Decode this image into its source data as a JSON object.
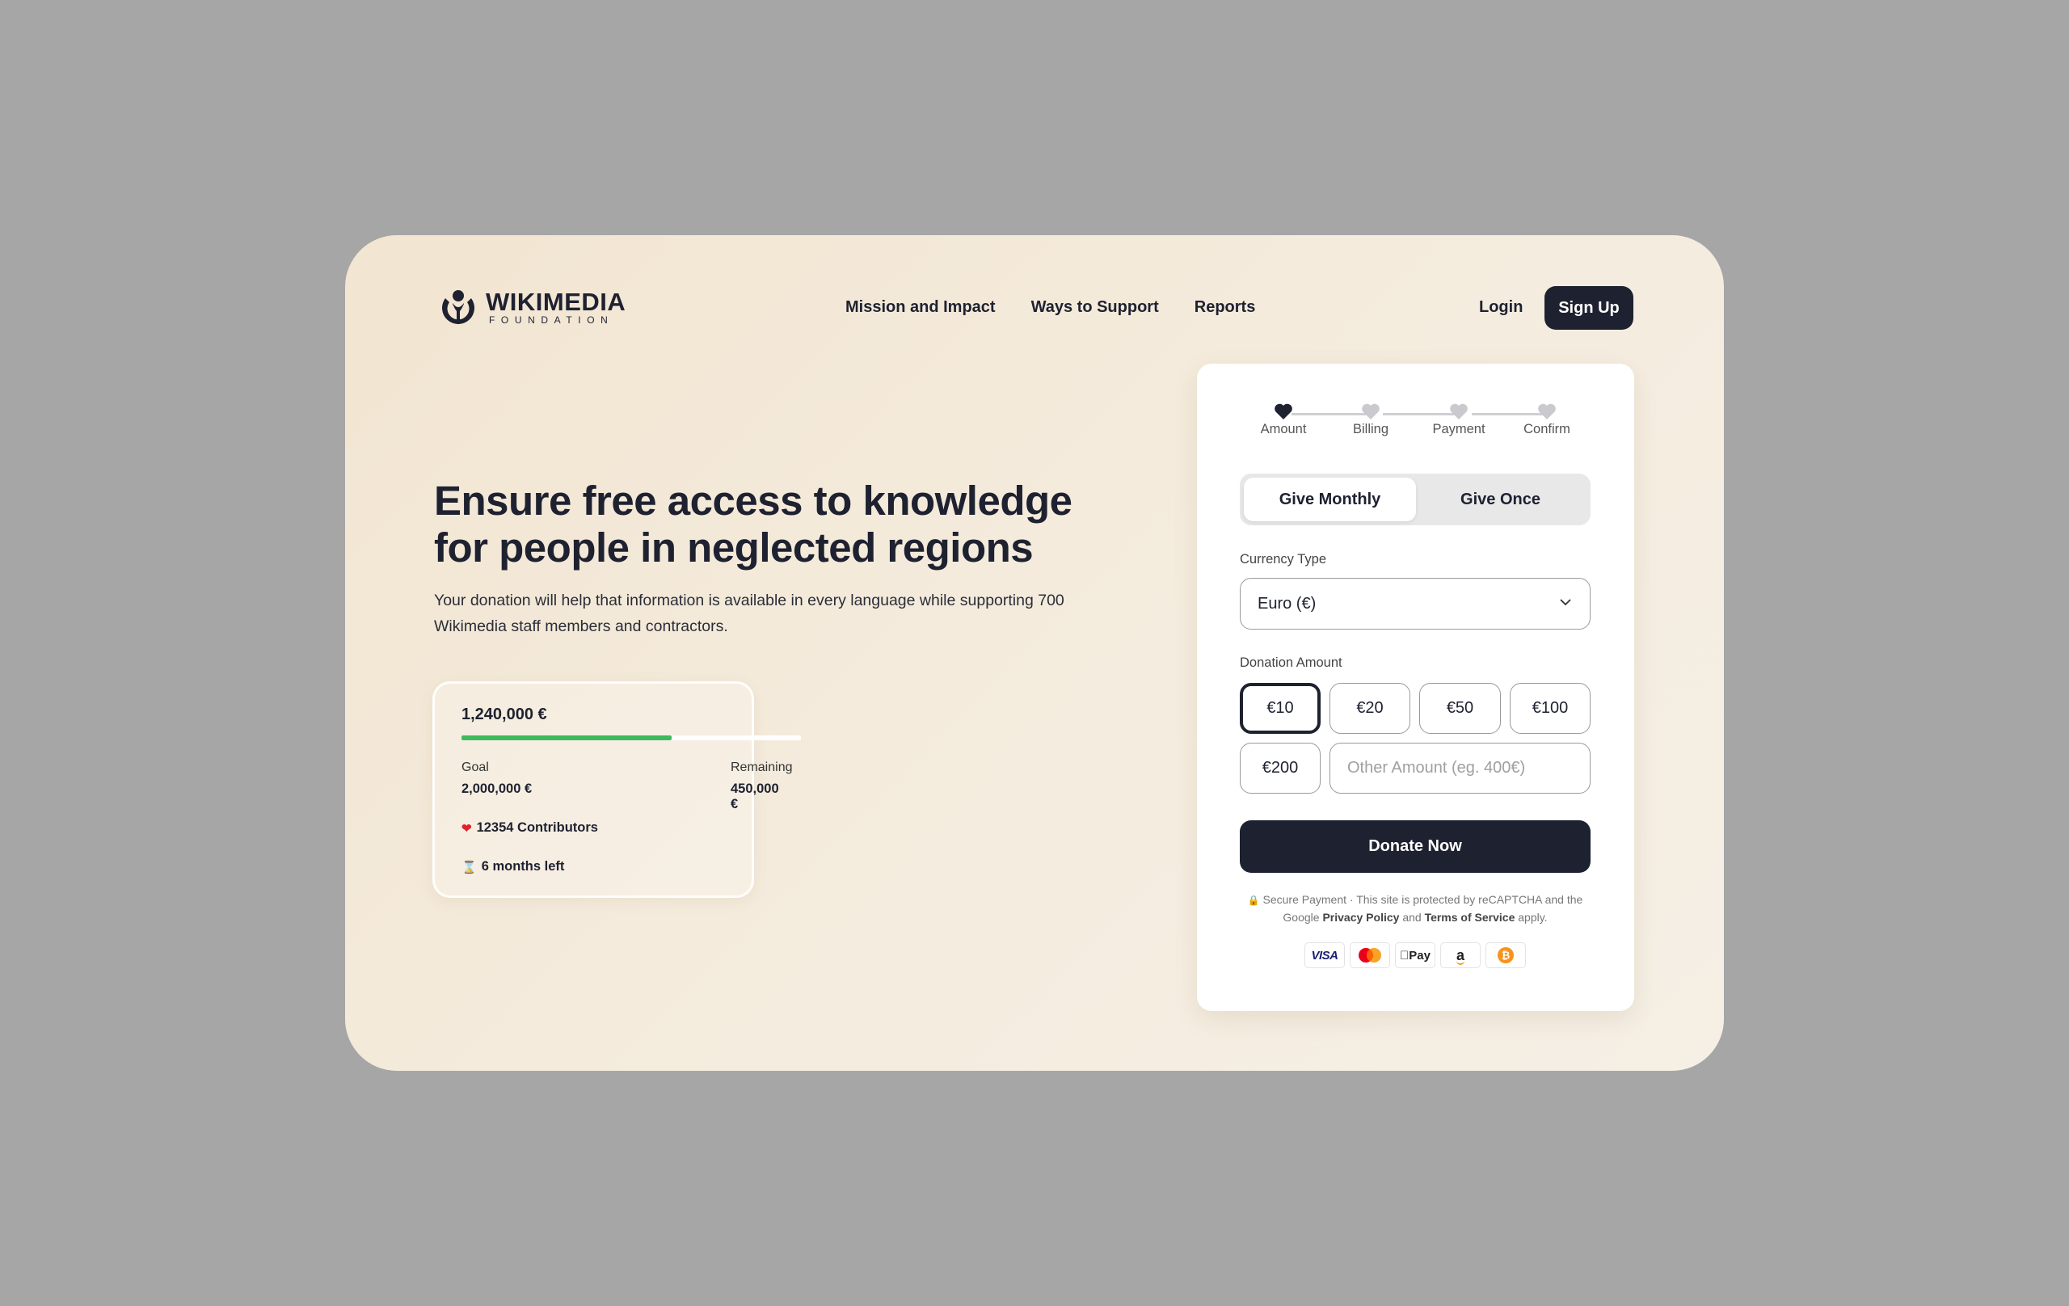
{
  "brand": {
    "name": "WIKIMEDIA",
    "subtitle": "FOUNDATION"
  },
  "nav": {
    "items": [
      {
        "label": "Mission and Impact"
      },
      {
        "label": "Ways to Support"
      },
      {
        "label": "Reports"
      }
    ],
    "login": "Login",
    "signup": "Sign Up"
  },
  "hero": {
    "title_line1": "Ensure free access to knowledge",
    "title_line2": "for people in neglected regions",
    "description": "Your donation will help that information is available in every language while supporting 700 Wikimedia staff members and contractors."
  },
  "stats": {
    "raised": "1,240,000 €",
    "progress_percent": 62,
    "goal_label": "Goal",
    "goal_value": "2,000,000 €",
    "remaining_label": "Remaining",
    "remaining_value": "450,000 €",
    "contributors": "12354 Contributors",
    "time_left": "6 months left"
  },
  "form": {
    "steps": [
      {
        "label": "Amount",
        "active": true
      },
      {
        "label": "Billing",
        "active": false
      },
      {
        "label": "Payment",
        "active": false
      },
      {
        "label": "Confirm",
        "active": false
      }
    ],
    "frequency": {
      "options": [
        "Give Monthly",
        "Give Once"
      ],
      "selected": "Give Monthly"
    },
    "currency_label": "Currency Type",
    "currency_value": "Euro (€)",
    "amount_label": "Donation Amount",
    "amounts": [
      "€10",
      "€20",
      "€50",
      "€100",
      "€200"
    ],
    "selected_amount": "€10",
    "other_placeholder": "Other Amount (eg. 400€)",
    "other_value": "",
    "donate_label": "Donate Now",
    "secure_prefix": "Secure Payment · This site is protected by reCAPTCHA and the Google",
    "privacy_link": "Privacy Policy",
    "secure_and": "and",
    "terms_link": "Terms of Service",
    "secure_suffix": "apply.",
    "payment_methods": [
      "VISA",
      "Mastercard",
      "Apple Pay",
      "Amazon Pay",
      "Bitcoin"
    ],
    "visa_text": "VISA",
    "applepay_text": "Pay",
    "amazon_text": "a"
  },
  "colors": {
    "primary": "#1e2130",
    "progress": "#3dba5c",
    "background": "#f2e5d1"
  }
}
